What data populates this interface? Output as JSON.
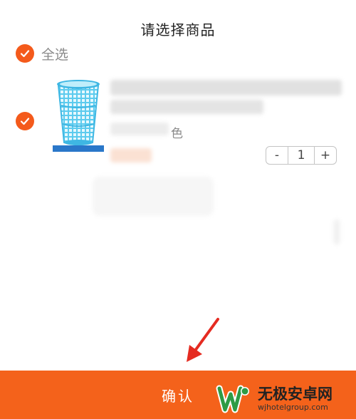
{
  "dialog": {
    "title": "请选择商品"
  },
  "select_all": {
    "label": "全选",
    "checked": true
  },
  "item": {
    "checked": true,
    "image_icon": "laundry-basket-image",
    "variant_suffix": "色",
    "quantity": "1",
    "minus_label": "-",
    "plus_label": "+"
  },
  "confirm_button": {
    "label": "确认"
  },
  "watermark": {
    "text": "无极安卓网",
    "url": "wjhotelgroup.com"
  },
  "colors": {
    "accent": "#f4621b",
    "check": "#f45a1b",
    "basket": "#4fc3ea"
  }
}
